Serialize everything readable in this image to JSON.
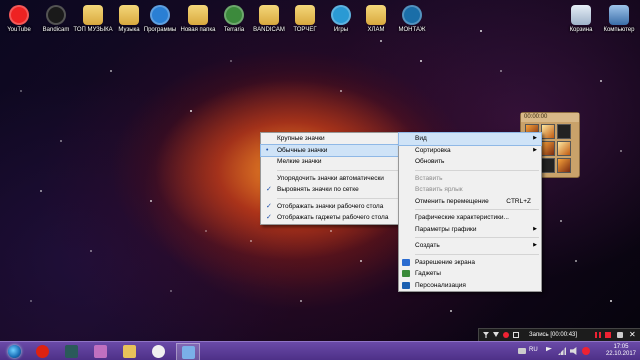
{
  "desktop_icons": [
    {
      "label": "YouTube",
      "icon": "youtube-icon",
      "color": "#e22"
    },
    {
      "label": "Bandicam",
      "icon": "bandicam-icon",
      "color": "#1a1a1a"
    },
    {
      "label": "ТОП МУЗЫКА",
      "icon": "folder-icon",
      "color": "#e8c15a"
    },
    {
      "label": "Музыка",
      "icon": "folder-icon",
      "color": "#e8c15a"
    },
    {
      "label": "Программы",
      "icon": "programs-icon",
      "color": "#2a7fd4"
    },
    {
      "label": "Новая папка",
      "icon": "folder-icon",
      "color": "#e8c15a"
    },
    {
      "label": "Terraria",
      "icon": "terraria-icon",
      "color": "#3c8a3c"
    },
    {
      "label": "BANDICAM",
      "icon": "folder-icon",
      "color": "#e8c15a"
    },
    {
      "label": "ТОРЧЕГ",
      "icon": "folder-icon",
      "color": "#e8c15a"
    },
    {
      "label": "Игры",
      "icon": "games-icon",
      "color": "#2a9ad4"
    },
    {
      "label": "ХЛАМ",
      "icon": "folder-icon",
      "color": "#e8c15a"
    },
    {
      "label": "МОНТАЖ",
      "icon": "montage-icon",
      "color": "#1a6ea8"
    }
  ],
  "right_icons": [
    {
      "label": "Корзина",
      "icon": "recycle-bin-icon"
    },
    {
      "label": "Компьютер",
      "icon": "computer-icon"
    }
  ],
  "gadget": {
    "title": "00:00:00"
  },
  "view_submenu": {
    "items": [
      {
        "label": "Крупные значки",
        "mark": ""
      },
      {
        "label": "Обычные значки",
        "mark": "•",
        "highlight": true
      },
      {
        "label": "Мелкие значки",
        "mark": ""
      },
      {
        "sep": true
      },
      {
        "label": "Упорядочить значки автоматически",
        "mark": ""
      },
      {
        "label": "Выровнять значки по сетке",
        "mark": "✓"
      },
      {
        "sep": true
      },
      {
        "label": "Отображать значки рабочего стола",
        "mark": "✓"
      },
      {
        "label": "Отображать гаджеты  рабочего стола",
        "mark": "✓"
      }
    ]
  },
  "context_menu": {
    "items": [
      {
        "label": "Вид",
        "arrow": true,
        "highlight": true
      },
      {
        "label": "Сортировка",
        "arrow": true
      },
      {
        "label": "Обновить"
      },
      {
        "sep": true
      },
      {
        "label": "Вставить",
        "disabled": true
      },
      {
        "label": "Вставить ярлык",
        "disabled": true
      },
      {
        "label": "Отменить перемещение",
        "shortcut": "CTRL+Z"
      },
      {
        "sep": true
      },
      {
        "label": "Графические характеристики..."
      },
      {
        "label": "Параметры графики",
        "arrow": true
      },
      {
        "sep": true
      },
      {
        "label": "Создать",
        "arrow": true
      },
      {
        "sep": true
      },
      {
        "label": "Разрешение экрана",
        "icon": "#2a6bd0"
      },
      {
        "label": "Гаджеты",
        "icon": "#3a8a3a"
      },
      {
        "label": "Персонализация",
        "icon": "#1a5fb0"
      }
    ]
  },
  "recorder": {
    "text": "Запись [00:00:43]"
  },
  "taskbar": {
    "apps": [
      {
        "name": "opera-icon",
        "color": "#d21"
      },
      {
        "name": "app2-icon",
        "color": "#2a5a5a"
      },
      {
        "name": "media-player-icon",
        "color": "#c070c0"
      },
      {
        "name": "explorer-icon",
        "color": "#e8c15a"
      },
      {
        "name": "yandex-icon",
        "color": "#f0f0f0"
      },
      {
        "name": "control-panel-icon",
        "color": "#7ab0e8"
      }
    ],
    "lang": "RU",
    "time": "17:05",
    "date": "22.10.2017"
  }
}
